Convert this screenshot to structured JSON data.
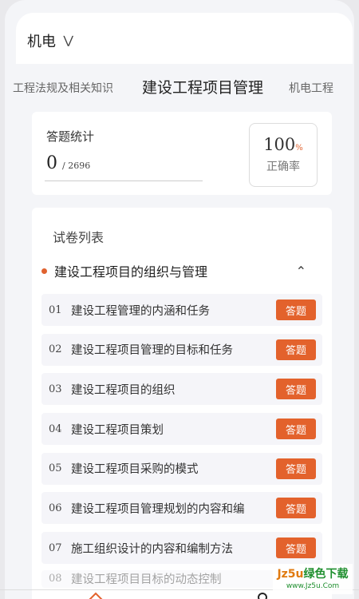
{
  "header": {
    "subject": "机电",
    "dropdown_icon": "double-chevron-down-icon"
  },
  "tabs": [
    "工程法规及相关知识",
    "建设工程项目管理",
    "机电工程"
  ],
  "stats": {
    "title": "答题统计",
    "answered": "0",
    "total": "/ 2696",
    "accuracy_value": "100",
    "accuracy_unit": "%",
    "accuracy_label": "正确率"
  },
  "paper_list": {
    "title": "试卷列表",
    "chapter": "建设工程项目的组织与管理",
    "collapse_icon": "chevron-up-icon",
    "items": [
      {
        "num": "01",
        "name": "建设工程管理的内涵和任务",
        "action": "答题"
      },
      {
        "num": "02",
        "name": "建设工程项目管理的目标和任务",
        "action": "答题"
      },
      {
        "num": "03",
        "name": "建设工程项目的组织",
        "action": "答题"
      },
      {
        "num": "04",
        "name": "建设工程项目策划",
        "action": "答题"
      },
      {
        "num": "05",
        "name": "建设工程项目采购的模式",
        "action": "答题"
      },
      {
        "num": "06",
        "name": "建设工程项目管理规划的内容和编",
        "action": "答题"
      },
      {
        "num": "07",
        "name": "施工组织设计的内容和编制方法",
        "action": "答题"
      },
      {
        "num": "08",
        "name": "建设工程项目目标的动态控制",
        "action": ""
      }
    ]
  },
  "watermark": {
    "prefix": "Jz5u",
    "suffix": "绿色下载",
    "url": "www.Jz5u.Com"
  },
  "colors": {
    "accent": "#e3622c",
    "background": "#f4f5f8",
    "watermark_green": "#1f8f2f"
  }
}
